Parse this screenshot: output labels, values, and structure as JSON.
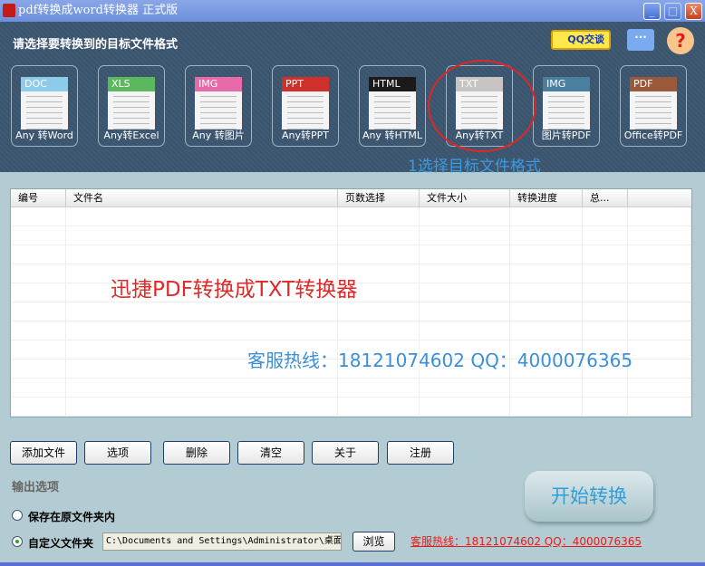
{
  "window": {
    "title": "pdf转换成word转换器 正式版",
    "minimize": "_",
    "maximize": "□",
    "close": "X"
  },
  "header": {
    "prompt": "请选择要转换到的目标文件格式",
    "qq_label": "QQ交谈",
    "chat_label": "···",
    "help_label": "?",
    "step_hint": "1选择目标文件格式",
    "formats": [
      {
        "tag": "DOC",
        "label": "Any 转Word",
        "color": "#8ecbe8"
      },
      {
        "tag": "XLS",
        "label": "Any转Excel",
        "color": "#5cb85c"
      },
      {
        "tag": "IMG",
        "label": "Any 转图片",
        "color": "#e86aa8"
      },
      {
        "tag": "PPT",
        "label": "Any转PPT",
        "color": "#d0302a"
      },
      {
        "tag": "HTML",
        "label": "Any 转HTML",
        "color": "#1a1a1a"
      },
      {
        "tag": "TXT",
        "label": "Any转TXT",
        "color": "#c8c4c4"
      },
      {
        "tag": "IMG",
        "label": "图片转PDF",
        "color": "#4a7fa0"
      },
      {
        "tag": "PDF",
        "label": "Office转PDF",
        "color": "#9a5a3a"
      }
    ]
  },
  "table": {
    "columns": [
      "编号",
      "文件名",
      "页数选择",
      "文件大小",
      "转换进度",
      "总..."
    ]
  },
  "watermark": {
    "title": "迅捷PDF转换成TXT转换器",
    "hotline": "客服热线：18121074602 QQ：4000076365"
  },
  "toolbar": {
    "add": "添加文件",
    "options": "选项",
    "delete": "删除",
    "clear": "清空",
    "about": "关于",
    "register": "注册"
  },
  "output": {
    "label": "输出选项",
    "opt_original": "保存在原文件夹内",
    "opt_custom": "自定义文件夹",
    "path": "C:\\Documents and Settings\\Administrator\\桌面",
    "browse": "浏览",
    "selected": "custom"
  },
  "hotline": "客服热线：18121074602 QQ：4000076365",
  "start": "开始转换"
}
